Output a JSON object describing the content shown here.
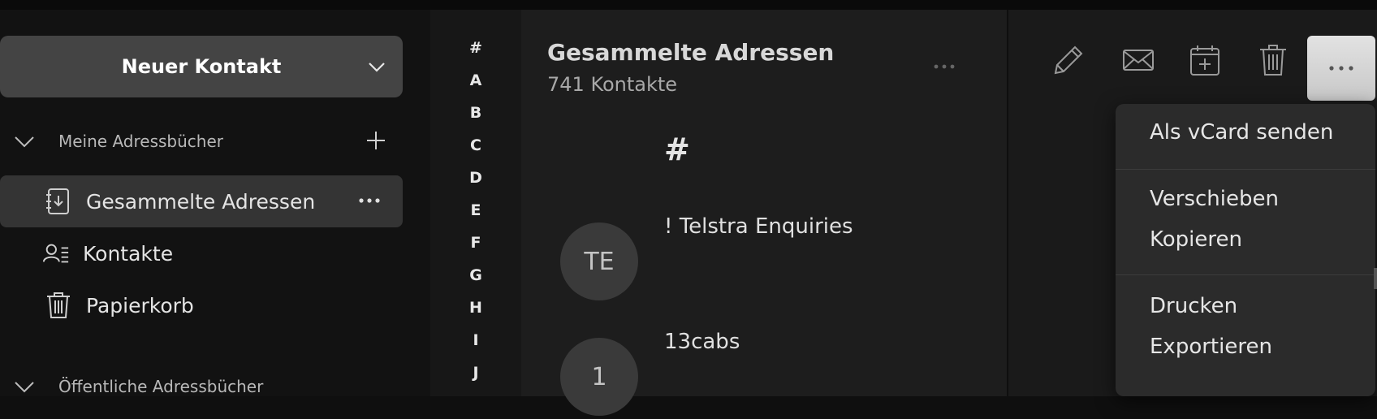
{
  "sidebar": {
    "new_contact_label": "Neuer Kontakt",
    "my_books_title": "Meine Adressbücher",
    "items": [
      {
        "label": "Gesammelte Adressen",
        "icon": "collected-addresses-icon"
      },
      {
        "label": "Kontakte",
        "icon": "contacts-icon"
      },
      {
        "label": "Papierkorb",
        "icon": "trash-icon"
      }
    ],
    "public_books_title": "Öffentliche Adressbücher"
  },
  "alphabet": [
    "#",
    "A",
    "B",
    "C",
    "D",
    "E",
    "F",
    "G",
    "H",
    "I",
    "J"
  ],
  "list": {
    "title": "Gesammelte Adressen",
    "count": "741 Kontakte",
    "group": "#",
    "contacts": [
      {
        "initials": "TE",
        "name": "! Telstra Enquiries"
      },
      {
        "initials": "1",
        "name": "13cabs"
      }
    ]
  },
  "toolbar": {
    "icons": [
      "edit-icon",
      "mail-icon",
      "calendar-add-icon",
      "delete-icon",
      "more-icon"
    ]
  },
  "menu": {
    "items": [
      "Als vCard senden",
      "Verschieben",
      "Kopieren",
      "Drucken",
      "Exportieren"
    ]
  },
  "colors": {
    "sidebar_bg": "#121212",
    "active_item_bg": "#343434",
    "list_bg": "#1d1d1d",
    "menu_bg": "#2b2b2b"
  }
}
